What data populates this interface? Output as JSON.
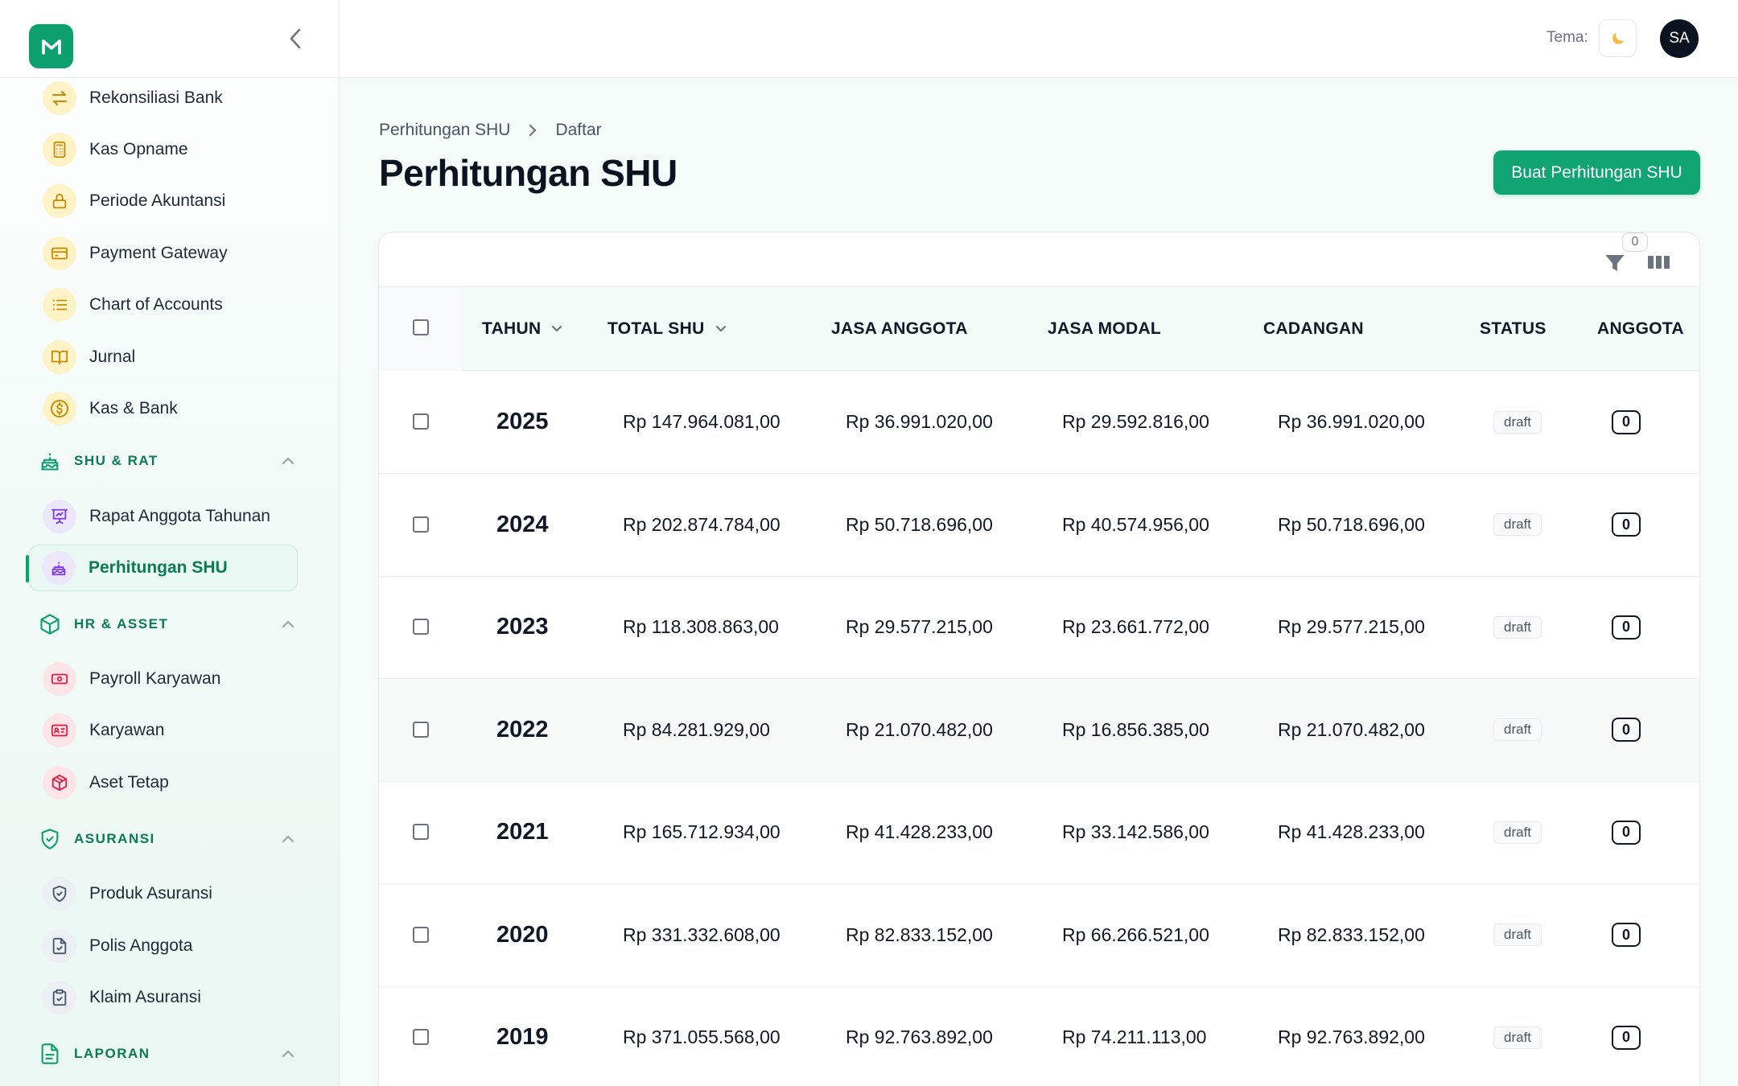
{
  "sidebar": {
    "items": [
      {
        "label": "Rekonsiliasi Bank",
        "icon": "arrows-exchange-icon",
        "tone": "y",
        "top": 0
      },
      {
        "label": "Kas Opname",
        "icon": "calculator-icon",
        "tone": "y"
      },
      {
        "label": "Periode Akuntansi",
        "icon": "lock-icon",
        "tone": "y"
      },
      {
        "label": "Payment Gateway",
        "icon": "credit-card-icon",
        "tone": "y"
      },
      {
        "label": "Chart of Accounts",
        "icon": "list-icon",
        "tone": "y"
      },
      {
        "label": "Jurnal",
        "icon": "book-icon",
        "tone": "y"
      },
      {
        "label": "Kas & Bank",
        "icon": "dollar-circle-icon",
        "tone": "y"
      }
    ],
    "section_shu": {
      "label": "SHU & RAT",
      "icon": "cake-icon"
    },
    "shu_items": [
      {
        "label": "Rapat Anggota Tahunan",
        "icon": "presentation-icon"
      },
      {
        "label": "Perhitungan SHU",
        "icon": "cake-icon",
        "active": true
      }
    ],
    "section_hr": {
      "label": "HR & ASSET",
      "icon": "box-icon"
    },
    "hr_items": [
      {
        "label": "Payroll Karyawan",
        "icon": "banknote-icon"
      },
      {
        "label": "Karyawan",
        "icon": "id-card-icon"
      },
      {
        "label": "Aset Tetap",
        "icon": "package-icon"
      }
    ],
    "section_asuransi": {
      "label": "ASURANSI",
      "icon": "shield-check-icon"
    },
    "asuransi_items": [
      {
        "label": "Produk Asuransi",
        "icon": "shield-icon"
      },
      {
        "label": "Polis Anggota",
        "icon": "file-check-icon"
      },
      {
        "label": "Klaim Asuransi",
        "icon": "clipboard-copy-icon"
      }
    ],
    "section_laporan": {
      "label": "LAPORAN",
      "icon": "file-text-icon"
    }
  },
  "topbar": {
    "theme_label": "Tema:",
    "theme_icon": "moon-icon",
    "avatar_initials": "SA"
  },
  "breadcrumb": {
    "parent": "Perhitungan SHU",
    "current": "Daftar"
  },
  "page_title": "Perhitungan SHU",
  "create_button": "Buat Perhitungan SHU",
  "toolbar": {
    "filter_count": "0"
  },
  "table": {
    "columns": {
      "tahun": "TAHUN",
      "total_shu": "TOTAL SHU",
      "jasa_anggota": "JASA ANGGOTA",
      "jasa_modal": "JASA MODAL",
      "cadangan": "CADANGAN",
      "status": "STATUS",
      "anggota": "ANGGOTA"
    },
    "rows": [
      {
        "tahun": "2025",
        "total": "Rp 147.964.081,00",
        "jasa_anggota": "Rp 36.991.020,00",
        "jasa_modal": "Rp 29.592.816,00",
        "cadangan": "Rp 36.991.020,00",
        "status": "draft",
        "anggota": "0"
      },
      {
        "tahun": "2024",
        "total": "Rp 202.874.784,00",
        "jasa_anggota": "Rp 50.718.696,00",
        "jasa_modal": "Rp 40.574.956,00",
        "cadangan": "Rp 50.718.696,00",
        "status": "draft",
        "anggota": "0"
      },
      {
        "tahun": "2023",
        "total": "Rp 118.308.863,00",
        "jasa_anggota": "Rp 29.577.215,00",
        "jasa_modal": "Rp 23.661.772,00",
        "cadangan": "Rp 29.577.215,00",
        "status": "draft",
        "anggota": "0"
      },
      {
        "tahun": "2022",
        "total": "Rp 84.281.929,00",
        "jasa_anggota": "Rp 21.070.482,00",
        "jasa_modal": "Rp 16.856.385,00",
        "cadangan": "Rp 21.070.482,00",
        "status": "draft",
        "anggota": "0"
      },
      {
        "tahun": "2021",
        "total": "Rp 165.712.934,00",
        "jasa_anggota": "Rp 41.428.233,00",
        "jasa_modal": "Rp 33.142.586,00",
        "cadangan": "Rp 41.428.233,00",
        "status": "draft",
        "anggota": "0"
      },
      {
        "tahun": "2020",
        "total": "Rp 331.332.608,00",
        "jasa_anggota": "Rp 82.833.152,00",
        "jasa_modal": "Rp 66.266.521,00",
        "cadangan": "Rp 82.833.152,00",
        "status": "draft",
        "anggota": "0"
      },
      {
        "tahun": "2019",
        "total": "Rp 371.055.568,00",
        "jasa_anggota": "Rp 92.763.892,00",
        "jasa_modal": "Rp 74.211.113,00",
        "cadangan": "Rp 92.763.892,00",
        "status": "draft",
        "anggota": "0"
      }
    ]
  },
  "colors": {
    "brand": "#0e9f6e",
    "active_text": "#0b7a55",
    "yellow_icon": "#ca8a04",
    "purple_icon": "#7c3aed",
    "red_icon": "#e11d48",
    "gray_icon": "#475569"
  }
}
